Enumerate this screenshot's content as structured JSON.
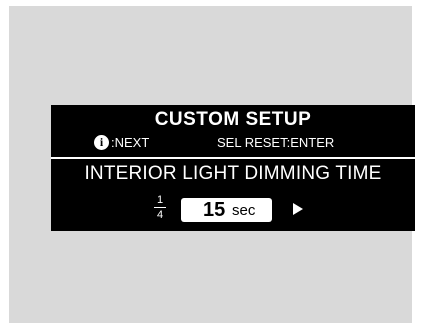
{
  "screen": {
    "title": "CUSTOM SETUP",
    "hints": {
      "info_symbol": "i",
      "left": ":NEXT",
      "right": "SEL RESET:ENTER"
    },
    "setting": {
      "name": "INTERIOR LIGHT DIMMING TIME",
      "page_numerator": "1",
      "page_denominator": "4",
      "value": "15",
      "unit": "sec"
    }
  },
  "colors": {
    "background": "#d9d9d9",
    "display": "#000000",
    "text": "#ffffff"
  },
  "icons": [
    "info-icon",
    "right-arrow-icon"
  ]
}
